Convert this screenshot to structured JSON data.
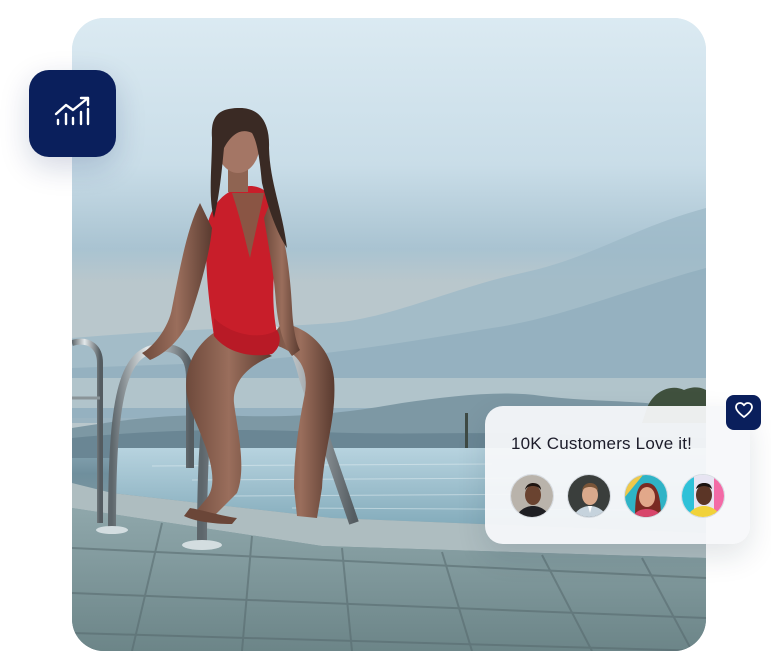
{
  "hero": {
    "photo": "woman-at-infinity-pool-ladder"
  },
  "badges": {
    "analytics_icon": "chart-growth-icon",
    "heart_icon": "heart-icon",
    "color": "#0a1f5c"
  },
  "customers": {
    "title": "10K Customers Love it!",
    "avatars": [
      "customer-1",
      "customer-2",
      "customer-3",
      "customer-4"
    ]
  }
}
